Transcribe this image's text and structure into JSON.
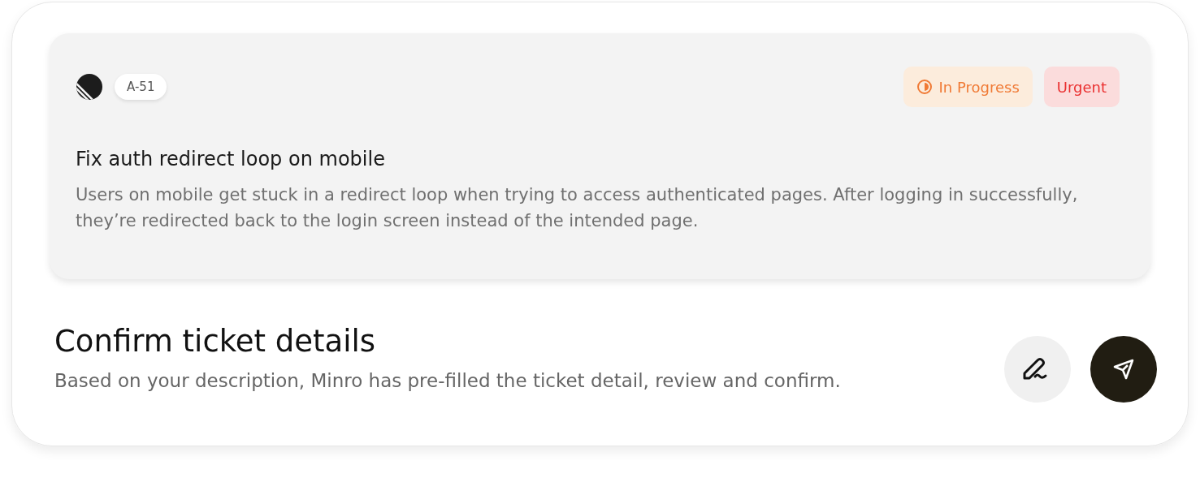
{
  "ticket": {
    "id": "A-51",
    "tags": [
      {
        "kind": "status",
        "label": "In Progress"
      },
      {
        "kind": "priority",
        "label": "Urgent"
      }
    ],
    "title": "Fix auth redirect loop on mobile",
    "description": "Users on mobile get stuck in a redirect loop when trying to access authenticated pages. After logging in successfully, they’re redirected back to the login screen instead of the intended page."
  },
  "heading": "Confirm ticket details",
  "subtitle": "Based on your description, Minro has pre-filled the ticket detail, review and confirm."
}
